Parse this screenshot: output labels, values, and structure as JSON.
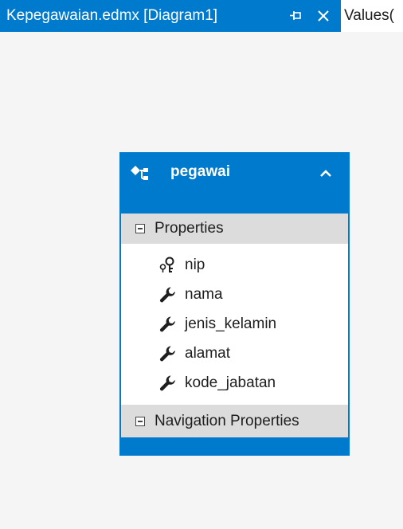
{
  "tabs": {
    "active": {
      "label": "Kepegawaian.edmx [Diagram1]",
      "pin_icon": "pin-icon",
      "close_icon": "close-icon"
    },
    "inactive": {
      "label": "Values("
    }
  },
  "entity": {
    "name": "pegawai",
    "icon": "entity-icon",
    "collapse_icon": "chevron-up-icon",
    "sections": {
      "properties": {
        "label": "Properties",
        "items": [
          {
            "label": "nip",
            "icon": "key-icon"
          },
          {
            "label": "nama",
            "icon": "wrench-icon"
          },
          {
            "label": "jenis_kelamin",
            "icon": "wrench-icon"
          },
          {
            "label": "alamat",
            "icon": "wrench-icon"
          },
          {
            "label": "kode_jabatan",
            "icon": "wrench-icon"
          }
        ]
      },
      "navigation": {
        "label": "Navigation Properties"
      }
    }
  },
  "colors": {
    "accent": "#007acc",
    "section_header_bg": "#dcdcdc",
    "canvas_bg": "#f5f5f5"
  }
}
